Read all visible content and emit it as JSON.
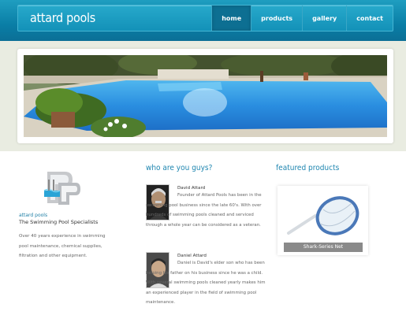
{
  "site": {
    "logo_text": "attard pools"
  },
  "nav": {
    "items": [
      {
        "label": "home",
        "active": true
      },
      {
        "label": "products",
        "active": false
      },
      {
        "label": "gallery",
        "active": false
      },
      {
        "label": "contact",
        "active": false
      }
    ]
  },
  "intro": {
    "brand_name": "attard pools",
    "tagline": "The Swimming Pool Specialists",
    "text": "Over 40 years experience in swimming pool maintenance, chemical supplies, filtration and other equipment."
  },
  "about": {
    "heading": "who are you guys?",
    "people": [
      {
        "name": "David Attard",
        "desc": "Founder of Attard Pools has been in the swimming pool business since the late 60's. With over hundreds of swimming pools cleaned and serviced through a whole year can be considered as a veteran."
      },
      {
        "name": "Daniel Attard",
        "desc": "Daniel is David's elder son who has been helping his father on his business since he was a child. With several swimming pools cleaned yearly makes him an experienced player in the field of swimming pool maintenance."
      }
    ]
  },
  "featured": {
    "heading": "featured products",
    "product_caption": "Shark-Series Net"
  },
  "colors": {
    "header_blue": "#0a7ea6",
    "heading_blue": "#1f86b0",
    "band_bg": "#e9ece1"
  }
}
